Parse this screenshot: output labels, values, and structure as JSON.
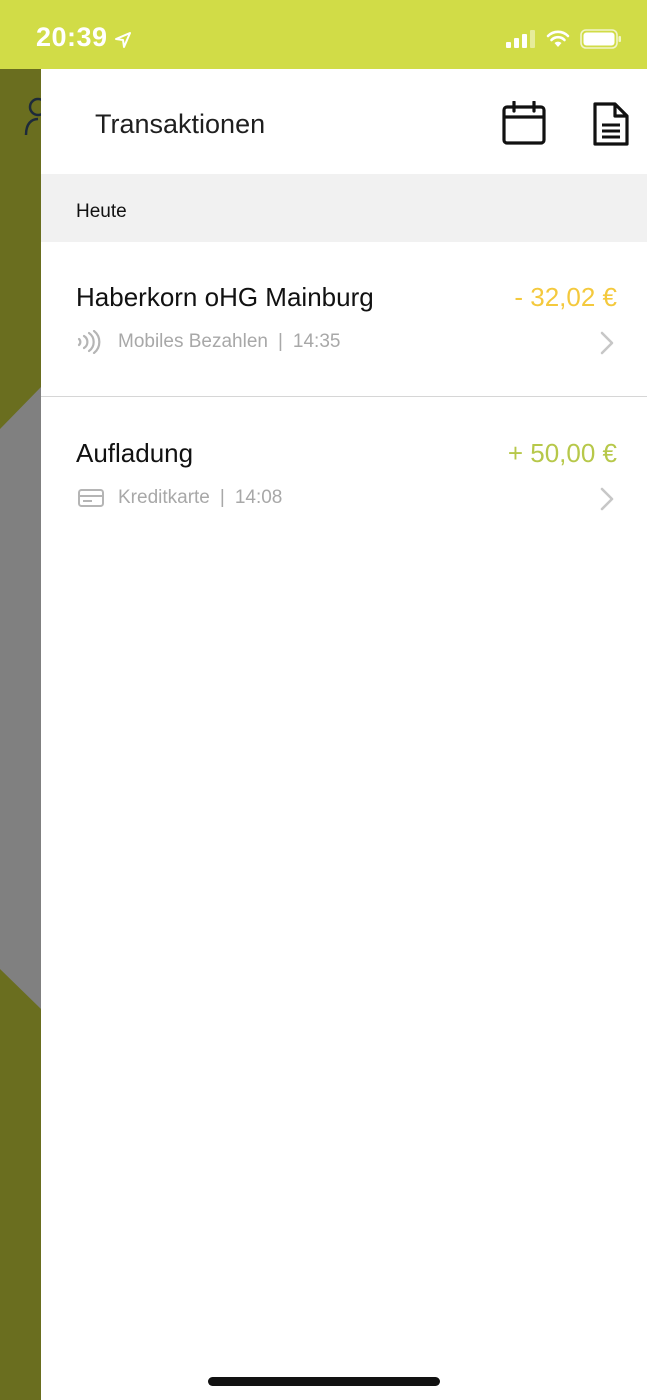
{
  "status_bar": {
    "time": "20:39",
    "background": "#d1dc47"
  },
  "background_app": {
    "color": "#6a6e1f",
    "gray_panel": "#808080"
  },
  "header": {
    "title": "Transaktionen",
    "calendar_icon": "calendar-icon",
    "document_icon": "document-icon"
  },
  "section": {
    "label": "Heute"
  },
  "transactions": [
    {
      "name": "Haberkorn oHG Mainburg",
      "amount": "- 32,02 €",
      "amount_color": "#f4c93d",
      "method": "Mobiles Bezahlen",
      "separator": "|",
      "time": "14:35",
      "method_icon": "contactless-icon"
    },
    {
      "name": "Aufladung",
      "amount": "+ 50,00 €",
      "amount_color": "#b7c84a",
      "method": "Kreditkarte",
      "separator": "|",
      "time": "14:08",
      "method_icon": "credit-card-icon"
    }
  ]
}
